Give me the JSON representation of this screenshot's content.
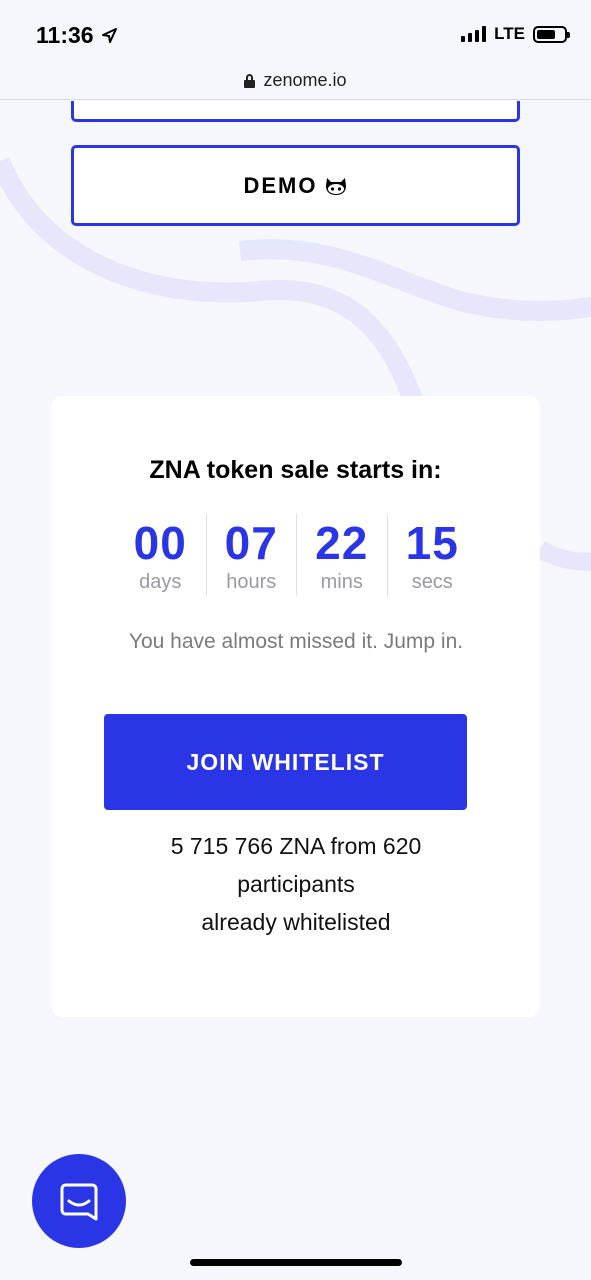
{
  "status_bar": {
    "time": "11:36",
    "network": "LTE",
    "location_icon": "location-arrow-icon"
  },
  "browser": {
    "url": "zenome.io"
  },
  "buttons": {
    "demo_label": "DEMO"
  },
  "sale_card": {
    "title": "ZNA token sale starts in:",
    "countdown": [
      {
        "value": "00",
        "unit": "days"
      },
      {
        "value": "07",
        "unit": "hours"
      },
      {
        "value": "22",
        "unit": "mins"
      },
      {
        "value": "15",
        "unit": "secs"
      }
    ],
    "notice": "You have almost missed it. Jump in.",
    "cta_label": "JOIN WHITELIST",
    "stats_line1": "5 715 766 ZNA from 620",
    "stats_line2": "participants",
    "stats_line3": "already whitelisted"
  },
  "colors": {
    "accent": "#2a36e6",
    "background": "#f6f6fd",
    "card": "#ffffff"
  }
}
